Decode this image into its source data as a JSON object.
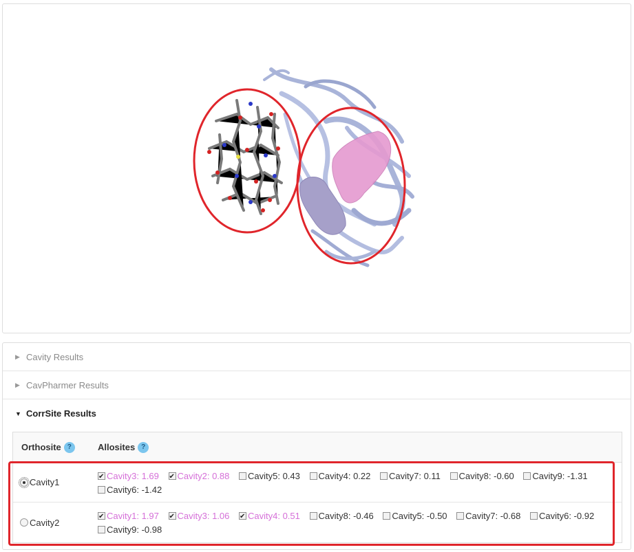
{
  "accordion": {
    "cavity_results": "Cavity Results",
    "cavpharmer_results": "CavPharmer Results",
    "corrsite_results": "CorrSite Results"
  },
  "table": {
    "headers": {
      "orthosite": "Orthosite",
      "allosites": "Allosites",
      "help": "?"
    },
    "rows": [
      {
        "orthosite": "Cavity1",
        "selected": true,
        "allosites": [
          {
            "label": "Cavity3: 1.69",
            "checked": true
          },
          {
            "label": "Cavity2: 0.88",
            "checked": true
          },
          {
            "label": "Cavity5: 0.43",
            "checked": false
          },
          {
            "label": "Cavity4: 0.22",
            "checked": false
          },
          {
            "label": "Cavity7: 0.11",
            "checked": false
          },
          {
            "label": "Cavity8: -0.60",
            "checked": false
          },
          {
            "label": "Cavity9: -1.31",
            "checked": false
          },
          {
            "label": "Cavity6: -1.42",
            "checked": false
          }
        ]
      },
      {
        "orthosite": "Cavity2",
        "selected": false,
        "allosites": [
          {
            "label": "Cavity1: 1.97",
            "checked": true
          },
          {
            "label": "Cavity3: 1.06",
            "checked": true
          },
          {
            "label": "Cavity4: 0.51",
            "checked": true
          },
          {
            "label": "Cavity8: -0.46",
            "checked": false
          },
          {
            "label": "Cavity5: -0.50",
            "checked": false
          },
          {
            "label": "Cavity7: -0.68",
            "checked": false
          },
          {
            "label": "Cavity6: -0.92",
            "checked": false
          },
          {
            "label": "Cavity9: -0.98",
            "checked": false
          }
        ]
      }
    ]
  },
  "colors": {
    "checked_text": "#d56fd8",
    "highlight_red": "#e0252b",
    "protein_ribbon": "#a9b4d9",
    "cavity_pink": "#e59ad0",
    "cavity_lavender": "#a6a0c9"
  }
}
